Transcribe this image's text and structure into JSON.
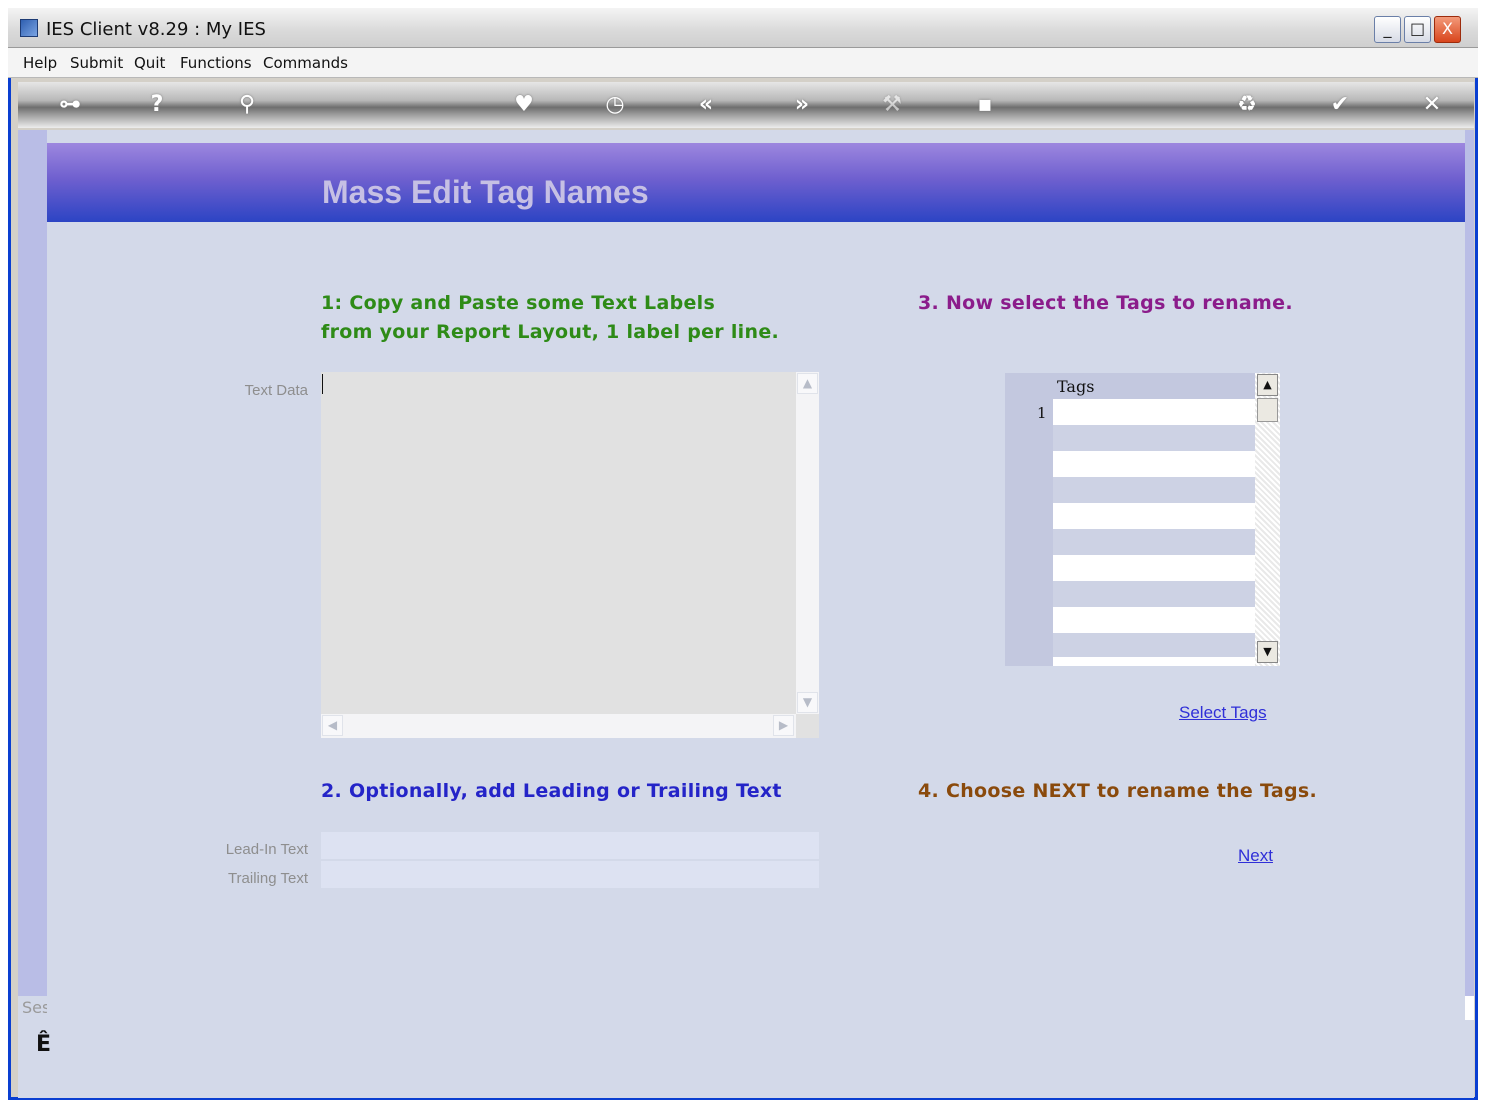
{
  "window": {
    "title": "IES Client v8.29 : My IES",
    "controls": {
      "minimize": "_",
      "maximize": "□",
      "close": "X"
    }
  },
  "menu": [
    "Help",
    "Submit",
    "Quit",
    "Functions",
    "Commands"
  ],
  "toolbar": {
    "icons": [
      "key-icon",
      "help-icon",
      "search-icon",
      "heart-icon",
      "clock-icon",
      "rewind-icon",
      "forward-icon",
      "tools-icon",
      "chip-icon",
      "recycle-icon",
      "check-icon",
      "close-icon"
    ]
  },
  "page": {
    "title": "Mass Edit Tag Names"
  },
  "step1": {
    "line1": "1: Copy and Paste some Text Labels",
    "line2": "from your Report Layout, 1 label per line.",
    "label": "Text Data",
    "value": ""
  },
  "step2": {
    "heading": "2. Optionally, add Leading or Trailing Text",
    "lead_in_label": "Lead-In Text",
    "lead_in_value": "",
    "trailing_label": "Trailing Text",
    "trailing_value": ""
  },
  "step3": {
    "heading": "3. Now select the Tags to rename.",
    "tags_header": "Tags",
    "row_number": "1",
    "select_link": "Select Tags"
  },
  "step4": {
    "heading": "4. Choose NEXT to rename the Tags.",
    "next_link": "Next"
  },
  "status": {
    "text": "Ses",
    "icon_glyph": "Ê"
  },
  "colors": {
    "step1": "#2e8b17",
    "step2": "#2424c8",
    "step3": "#8b1c8b",
    "step4": "#8a4a0c"
  }
}
